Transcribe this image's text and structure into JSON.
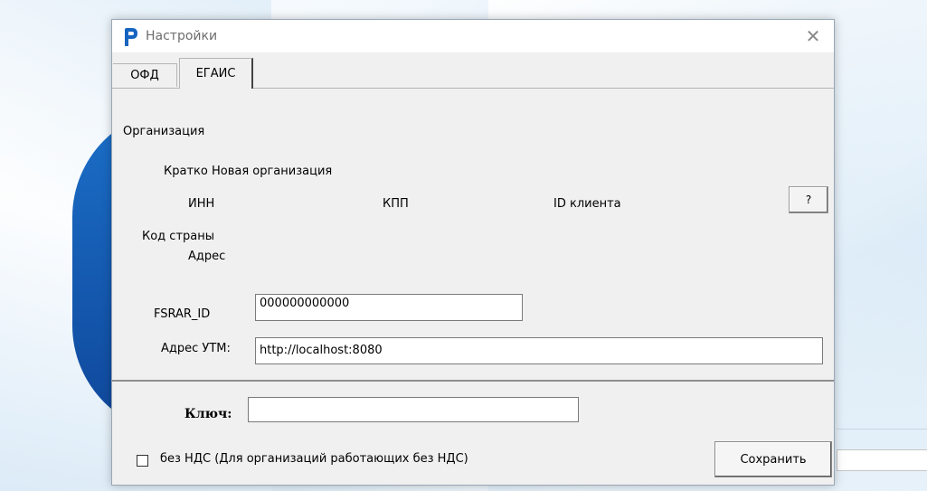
{
  "window": {
    "title": "Настройки",
    "close_glyph": "✕"
  },
  "tabs": [
    {
      "label": "ОФД",
      "active": false
    },
    {
      "label": "ЕГАИС",
      "active": true
    }
  ],
  "organization": {
    "section_label": "Организация",
    "short_name": "Кратко Новая организация",
    "inn_label": "ИНН",
    "kpp_label": "КПП",
    "client_id_label": "ID клиента",
    "help_button": "?",
    "country_code_label": "Код страны",
    "address_label": "Адрес"
  },
  "fields": {
    "fsrar_label": "FSRAR_ID",
    "fsrar_value": "000000000000",
    "utm_label": "Адрес УТМ:",
    "utm_value": "http://localhost:8080"
  },
  "footer": {
    "key_label": "Ключ:",
    "key_value": "",
    "no_vat_label": "без НДС (Для организаций работающих без НДС)",
    "no_vat_checked": false,
    "save_label": "Сохранить"
  },
  "colors": {
    "logo_blue": "#1565c0",
    "backdrop_blue": "#1457ad"
  },
  "icons": {
    "app_logo": "app-logo-icon",
    "close": "close-icon"
  }
}
